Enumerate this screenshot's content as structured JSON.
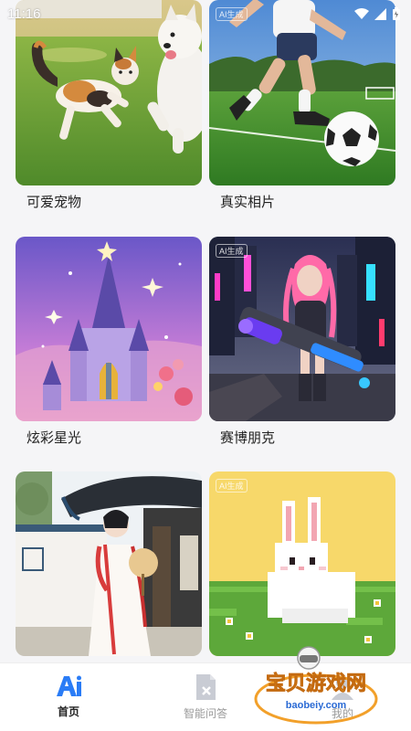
{
  "status_bar": {
    "time": "11:16"
  },
  "cards": [
    {
      "label": "可爱宠物",
      "badge": ""
    },
    {
      "label": "真实相片",
      "badge": "AI生成"
    },
    {
      "label": "炫彩星光",
      "badge": ""
    },
    {
      "label": "赛博朋克",
      "badge": "AI生成"
    },
    {
      "label": "",
      "badge": ""
    },
    {
      "label": "",
      "badge": "AI生成"
    }
  ],
  "tab_bar": {
    "tabs": [
      {
        "label": "首页",
        "icon": "ai-logo-icon",
        "active": true
      },
      {
        "label": "智能问答",
        "icon": "qa-document-icon",
        "active": false
      },
      {
        "label": "我的",
        "icon": "user-icon",
        "active": false
      }
    ]
  },
  "watermark": {
    "title": "宝贝游戏网",
    "url": "baobeiy.com"
  },
  "colors": {
    "accent": "#2a7cf6",
    "background": "#f5f5f7"
  }
}
